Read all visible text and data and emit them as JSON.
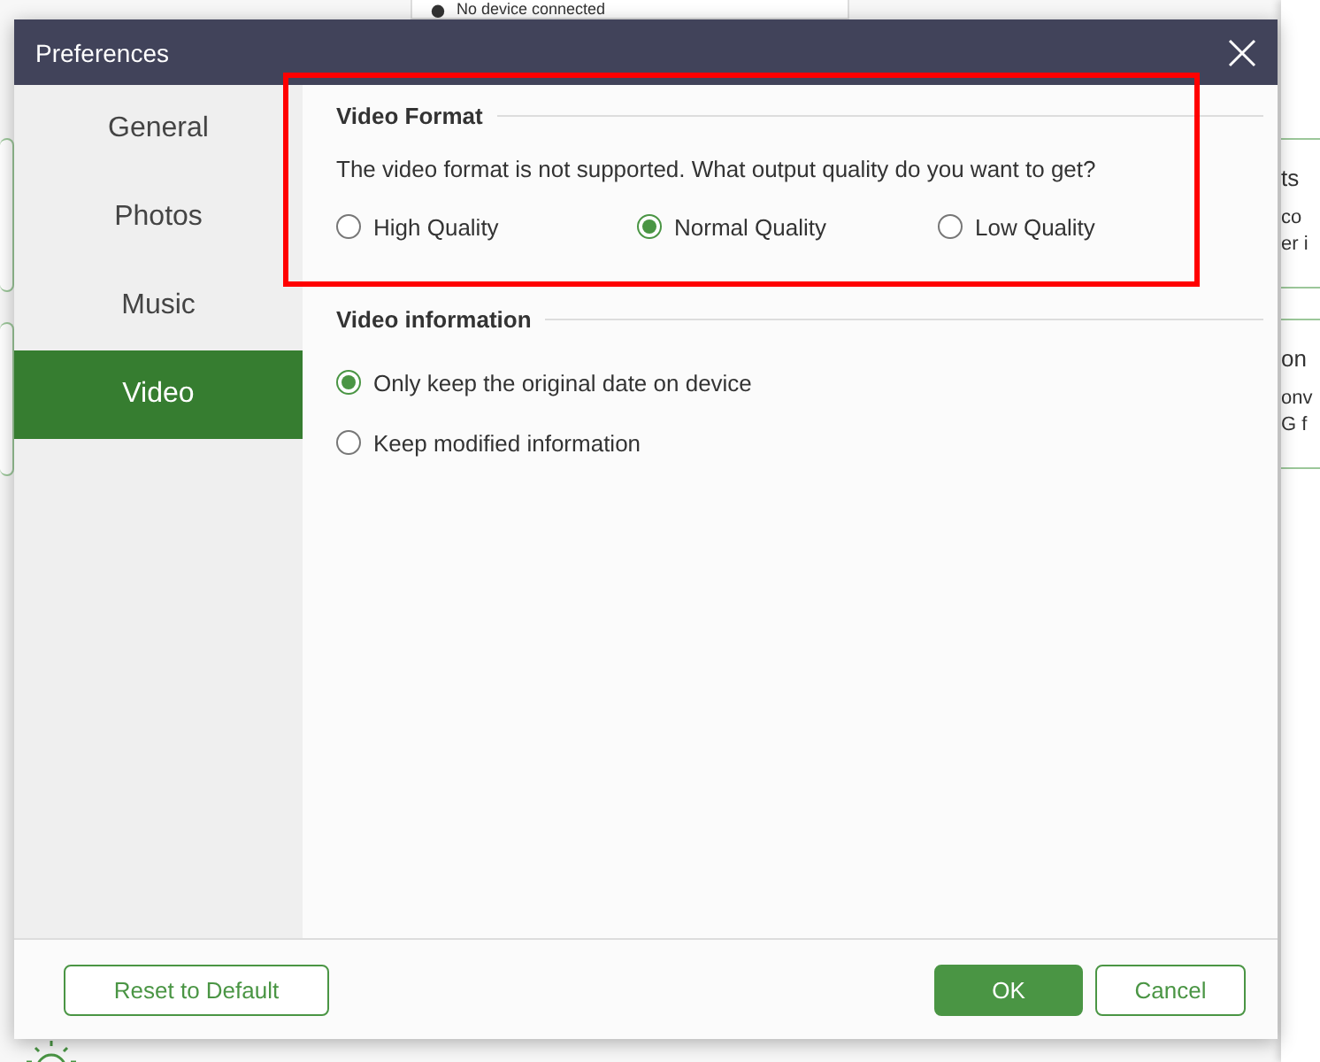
{
  "background": {
    "device_selector": {
      "label": "No device connected"
    },
    "side_panels": [
      {
        "lines": [
          "ts",
          "co",
          "er i"
        ]
      },
      {
        "lines": [
          "on",
          "onv",
          "G f"
        ]
      }
    ]
  },
  "dialog": {
    "title": "Preferences",
    "sidebar": {
      "items": [
        {
          "label": "General",
          "selected": false
        },
        {
          "label": "Photos",
          "selected": false
        },
        {
          "label": "Music",
          "selected": false
        },
        {
          "label": "Video",
          "selected": true
        }
      ]
    },
    "sections": [
      {
        "title": "Video Format",
        "description": "The video format is not supported. What output quality do you want to get?",
        "options": [
          {
            "label": "High Quality",
            "selected": false
          },
          {
            "label": "Normal Quality",
            "selected": true
          },
          {
            "label": "Low Quality",
            "selected": false
          }
        ]
      },
      {
        "title": "Video information",
        "options": [
          {
            "label": "Only keep the original date on device",
            "selected": true
          },
          {
            "label": "Keep modified information",
            "selected": false
          }
        ]
      }
    ],
    "annotation": {
      "color": "#ff0000"
    },
    "buttons": [
      {
        "label": "Reset to Default",
        "kind": "secondary"
      },
      {
        "label": "OK",
        "kind": "primary"
      },
      {
        "label": "Cancel",
        "kind": "secondary"
      }
    ]
  }
}
